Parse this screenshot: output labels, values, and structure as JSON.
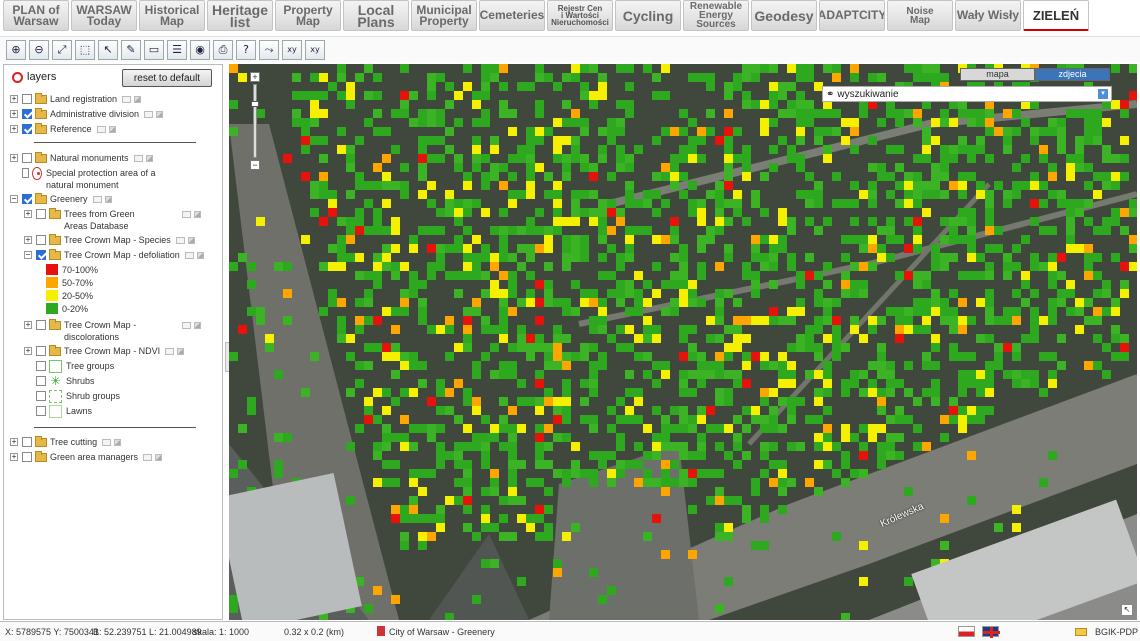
{
  "tabs": [
    {
      "label": "PLAN of\nWarsaw",
      "style": "mid",
      "w": 66
    },
    {
      "label": "WARSAW\nToday",
      "style": "mid",
      "w": 66
    },
    {
      "label": "Historical\nMap",
      "style": "mid",
      "w": 66
    },
    {
      "label": "Heritage\nlist",
      "style": "big",
      "w": 66
    },
    {
      "label": "Property\nMap",
      "style": "mid",
      "w": 66
    },
    {
      "label": "Local\nPlans",
      "style": "big",
      "w": 66
    },
    {
      "label": "Municipal\nProperty",
      "style": "mid",
      "w": 66
    },
    {
      "label": "Cemeteries",
      "style": "mid",
      "w": 66
    },
    {
      "label": "Rejestr Cen\ni Wartości\nNieruchomości",
      "style": "tiny",
      "w": 66
    },
    {
      "label": "Cycling",
      "style": "big",
      "w": 66
    },
    {
      "label": "Renewable\nEnergy\nSources",
      "style": "small",
      "w": 66
    },
    {
      "label": "Geodesy",
      "style": "big",
      "w": 66
    },
    {
      "label": "ADAPTCITY",
      "style": "mid",
      "w": 66
    },
    {
      "label": "Noise\nMap",
      "style": "small",
      "w": 66
    },
    {
      "label": "Wały Wisły",
      "style": "mid",
      "w": 66
    },
    {
      "label": "ZIELEŃ",
      "style": "active",
      "w": 66
    }
  ],
  "toolbar": {
    "icons": [
      "zoom-in-icon",
      "zoom-out-icon",
      "zoom-extent-icon",
      "zoom-window-icon",
      "select-pointer-icon",
      "identify-icon",
      "measure-icon",
      "legend-icon",
      "globe-icon",
      "print-icon",
      "help-icon",
      "trace-icon",
      "coordinate-xy-icon",
      "coordinate-xy-transform-icon"
    ],
    "glyphs": [
      "⊕",
      "⊖",
      "⤢",
      "⬚",
      "↖",
      "✎",
      "▭",
      "☰",
      "◉",
      "⎙",
      "?",
      "⤳",
      "xy",
      "xy"
    ]
  },
  "panel": {
    "title": "layers",
    "reset_label": "reset to default",
    "rows": {
      "land": "Land registration",
      "admin": "Administrative division",
      "reference": "Reference",
      "natural": "Natural monuments",
      "protection": "Special protection area of a natural monument",
      "greenery": "Greenery",
      "trees_db": "Trees from Green Areas Database",
      "crown_species": "Tree Crown Map - Species",
      "crown_defol": "Tree Crown Map - defoliation",
      "crown_discol": "Tree Crown Map - discolorations",
      "crown_ndvi": "Tree Crown Map - NDVI",
      "tree_groups": "Tree groups",
      "shrubs": "Shrubs",
      "shrub_groups": "Shrub groups",
      "lawns": "Lawns",
      "tree_cutting": "Tree cutting",
      "managers": "Green area managers"
    },
    "legend": [
      {
        "label": "70-100%",
        "color": "#e8120c"
      },
      {
        "label": "50-70%",
        "color": "#ffa500"
      },
      {
        "label": "20-50%",
        "color": "#f5f000"
      },
      {
        "label": "0-20%",
        "color": "#2ea81e"
      }
    ]
  },
  "map": {
    "type_buttons": {
      "map": "mapa",
      "photo": "zdjecia"
    },
    "search_label": "wyszukiwanie",
    "street_label": "Królewska"
  },
  "status": {
    "xy": "X: 5789575 Y: 7500341",
    "bl": "B: 52.239751 L: 21.004989",
    "scale": "skala: 1: 1000",
    "extent": "0.32 x 0.2 (km)",
    "source": "City of Warsaw - Greenery",
    "credit": "BGIK-PDP"
  }
}
